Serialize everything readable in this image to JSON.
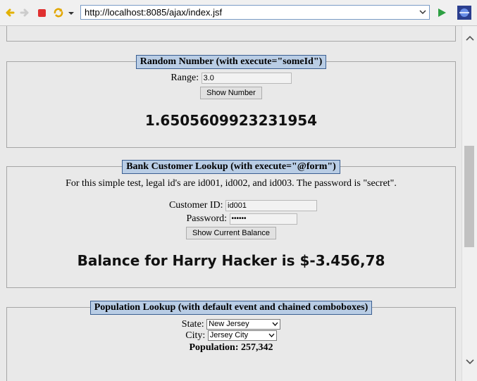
{
  "browser": {
    "url": "http://localhost:8085/ajax/index.jsf"
  },
  "random_panel": {
    "legend": "Random Number (with execute=\"someId\")",
    "range_label": "Range:",
    "range_value": "3.0",
    "button": "Show Number",
    "result": "1.6505609923231954"
  },
  "bank_panel": {
    "legend": "Bank Customer Lookup (with execute=\"@form\")",
    "info": "For this simple test, legal id's are id001, id002, and id003. The password is \"secret\".",
    "customer_label": "Customer ID:",
    "customer_value": "id001",
    "password_label": "Password:",
    "password_value": "••••••",
    "button": "Show Current Balance",
    "result": "Balance for Harry Hacker is $-3.456,78"
  },
  "population_panel": {
    "legend": "Population Lookup (with default event and chained comboboxes)",
    "state_label": "State:",
    "state_value": "New Jersey",
    "city_label": "City:",
    "city_value": "Jersey City",
    "population": "Population: 257,342"
  }
}
